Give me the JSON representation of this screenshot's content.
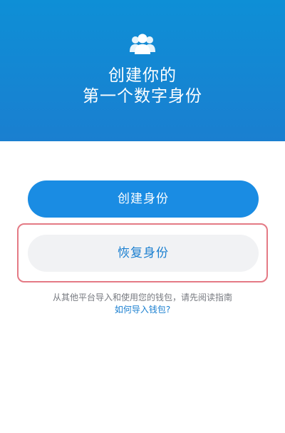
{
  "hero": {
    "title_line1": "创建你的",
    "title_line2": "第一个数字身份",
    "icon": "people-icon",
    "background": "#1a84d3"
  },
  "actions": {
    "create_label": "创建身份",
    "restore_label": "恢复身份",
    "primary_color": "#1a8ce3",
    "highlight_color": "#e47a85"
  },
  "footer": {
    "hint_text": "从其他平台导入和使用您的钱包，请先阅读指南",
    "link_text": "如何导入钱包?"
  }
}
